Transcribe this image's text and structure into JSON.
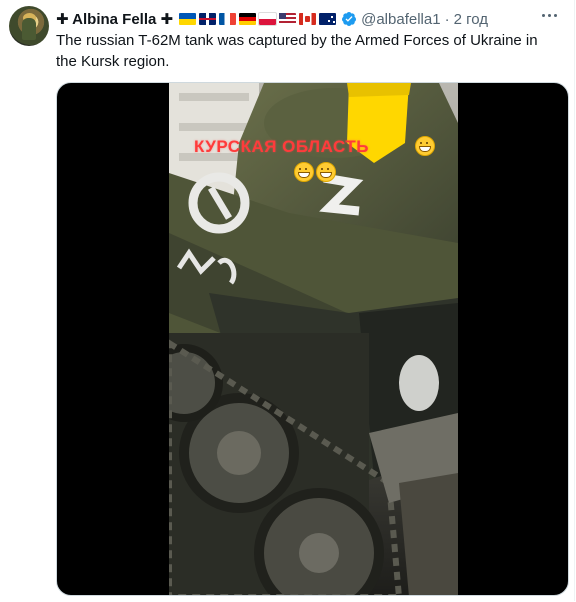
{
  "tweet": {
    "author_name": "✚ Albina Fella ✚",
    "flags": [
      "flag-ukraine-icon",
      "flag-uk-icon",
      "flag-france-icon",
      "flag-germany-icon",
      "flag-poland-icon",
      "flag-usa-icon",
      "flag-canada-icon",
      "flag-australia-icon"
    ],
    "verified": true,
    "handle": "@albafella1",
    "separator": "·",
    "time": "2 год",
    "text": "The russian T-62M tank was captured by the Armed Forces of Ukraine in the Kursk region."
  },
  "media": {
    "overlay_text": "КУРСКАЯ ОБЛАСТЬ",
    "emoji_name": "grinning-face-icon"
  },
  "colors": {
    "text_primary": "#0f1419",
    "text_secondary": "#536471",
    "verified_blue": "#1d9bf0",
    "overlay_red": "#ff3b3b",
    "flag_yellow": "#ffd700",
    "flag_blue": "#0057b7"
  }
}
